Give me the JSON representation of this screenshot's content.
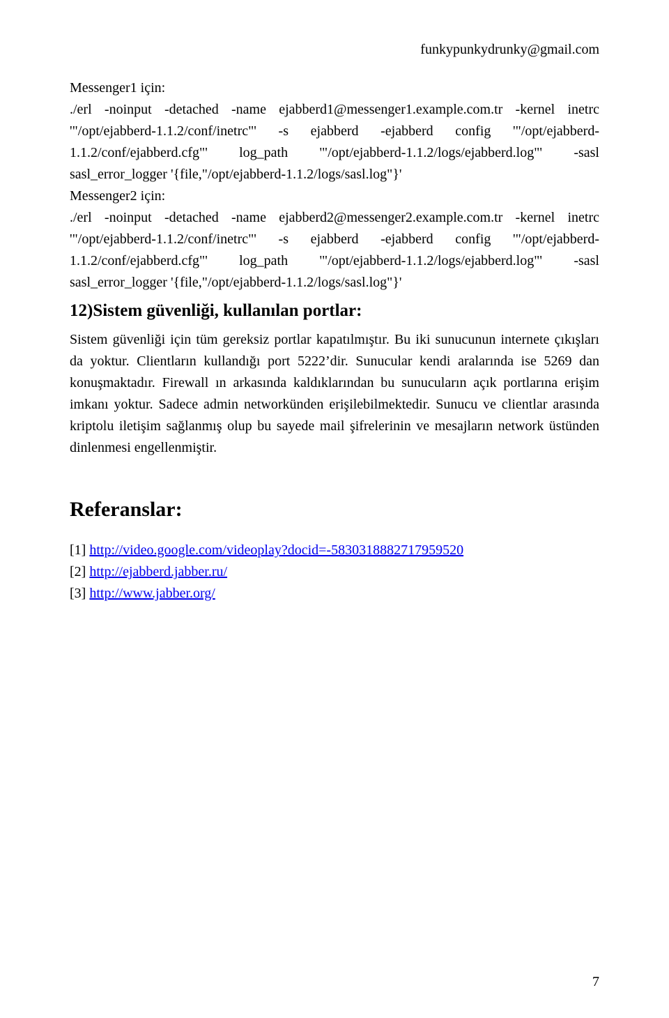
{
  "header": {
    "email": "funkypunkydrunky@gmail.com"
  },
  "body": {
    "msg1_label": "Messenger1 için:",
    "cmd1": "./erl -noinput -detached -name ejabberd1@messenger1.example.com.tr -kernel inetrc '\"/opt/ejabberd-1.1.2/conf/inetrc\"' -s ejabberd -ejabberd config '\"/opt/ejabberd-1.1.2/conf/ejabberd.cfg\"' log_path '\"/opt/ejabberd-1.1.2/logs/ejabberd.log\"' -sasl sasl_error_logger '{file,\"/opt/ejabberd-1.1.2/logs/sasl.log\"}'",
    "msg2_label": "Messenger2 için:",
    "cmd2": "./erl -noinput -detached -name ejabberd2@messenger2.example.com.tr -kernel inetrc '\"/opt/ejabberd-1.1.2/conf/inetrc\"' -s ejabberd -ejabberd config '\"/opt/ejabberd-1.1.2/conf/ejabberd.cfg\"' log_path '\"/opt/ejabberd-1.1.2/logs/ejabberd.log\"' -sasl sasl_error_logger '{file,\"/opt/ejabberd-1.1.2/logs/sasl.log\"}'",
    "section12_title": "12)Sistem güvenliği, kullanılan portlar:",
    "section12_body": "Sistem güvenliği için tüm gereksiz portlar kapatılmıştır. Bu iki sunucunun internete çıkışları da yoktur. Clientların kullandığı port 5222’dir. Sunucular kendi aralarında ise 5269 dan konuşmaktadır. Firewall ın arkasında kaldıklarından bu sunucuların açık portlarına erişim imkanı yoktur. Sadece admin networkünden erişilebilmektedir. Sunucu ve clientlar arasında kriptolu iletişim sağlanmış olup bu sayede mail şifrelerinin ve mesajların network üstünden dinlenmesi engellenmiştir.",
    "references_title": "Referanslar:",
    "ref1_prefix": "[1] ",
    "ref1_link": "http://video.google.com/videoplay?docid=-5830318882717959520",
    "ref2_prefix": "[2] ",
    "ref2_link": "http://ejabberd.jabber.ru/",
    "ref3_prefix": "[3] ",
    "ref3_link": "http://www.jabber.org/"
  },
  "page_number": "7"
}
